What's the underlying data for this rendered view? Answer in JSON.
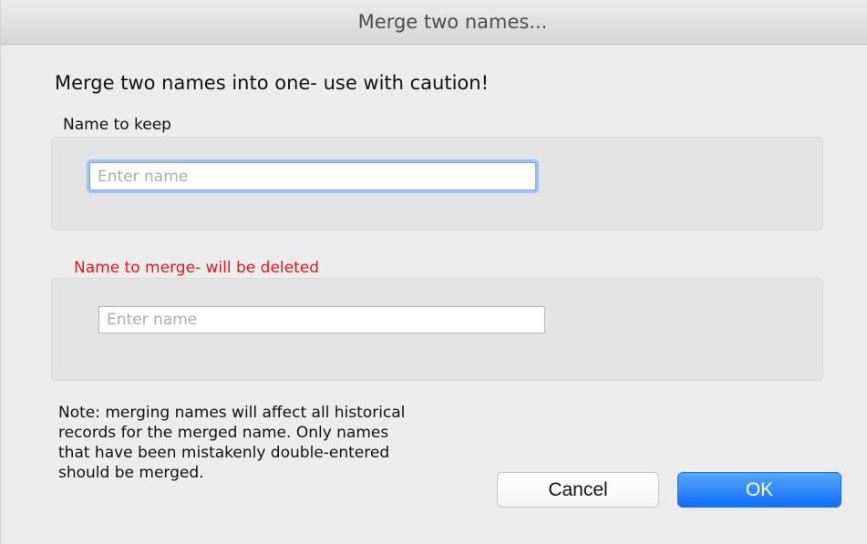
{
  "window": {
    "title": "Merge two names..."
  },
  "dialog": {
    "heading": "Merge two names into one- use with caution!",
    "keep_group": {
      "label": "Name to keep",
      "input_placeholder": "Enter name",
      "input_value": ""
    },
    "merge_group": {
      "label": "Name to merge- will be deleted",
      "label_color": "#e8171b",
      "input_placeholder": "Enter name",
      "input_value": ""
    },
    "note": "Note: merging names will affect all historical\nrecords for the merged name. Only names\nthat have been mistakenly double-entered\nshould be merged."
  },
  "buttons": {
    "cancel_label": "Cancel",
    "ok_label": "OK"
  },
  "colors": {
    "accent": "#0e6efb",
    "focus_ring": "#9fc2f2"
  }
}
